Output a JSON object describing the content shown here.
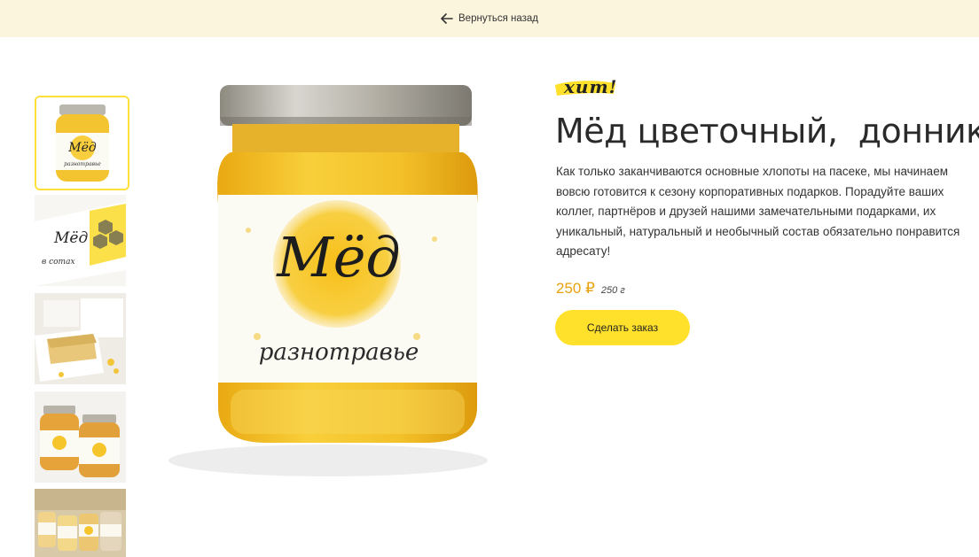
{
  "header": {
    "back_label": "Вернуться назад",
    "back_icon": "arrow-left-icon",
    "background": "#fbf5dd"
  },
  "gallery": {
    "thumbnails": [
      {
        "name": "thumb-jar-front",
        "active": true
      },
      {
        "name": "thumb-honeycomb-box",
        "active": false
      },
      {
        "name": "thumb-gift-box",
        "active": false
      },
      {
        "name": "thumb-two-jars",
        "active": false
      },
      {
        "name": "thumb-jar-collection",
        "active": false
      }
    ],
    "active_border_color": "#ffe03a"
  },
  "product": {
    "badge": "хит!",
    "title": "Мёд цветочный,  донник",
    "description": "Как только заканчиваются основные хлопоты на пасеке, мы начинаем вовсю готовится к сезону корпоративных подарков. Порадуйте ваших коллег, партнёров и друзей нашими замечательными подарками, их уникальный, натуральный и необычный состав обязательно понравится адресату!",
    "price": "250 ₽",
    "weight": "250 г",
    "order_button": "Сделать заказ",
    "accent_color": "#ffe12b",
    "price_color": "#e8a20c"
  },
  "label_art": {
    "main_word": "Мёд",
    "sub_word": "разнотравье",
    "thumb_word": "в сотах"
  }
}
